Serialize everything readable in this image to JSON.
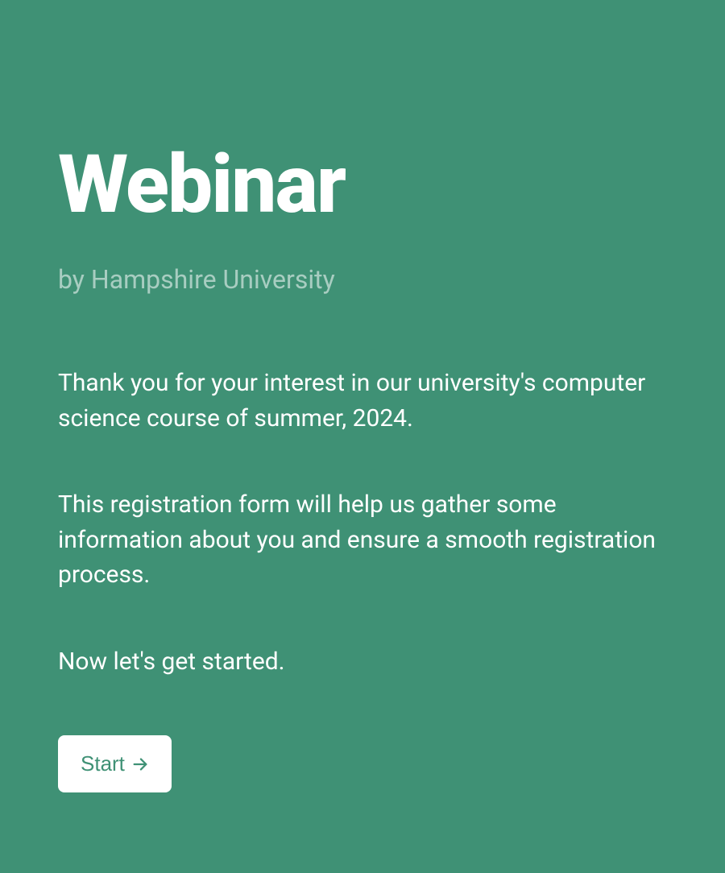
{
  "header": {
    "title": "Webinar",
    "subtitle": "by Hampshire University"
  },
  "body": {
    "paragraph1": "Thank you for your interest in our university's computer science course of summer, 2024.",
    "paragraph2": "This registration form will help us gather some information about you and ensure a smooth registration process.",
    "paragraph3": "Now let's get started."
  },
  "actions": {
    "start_label": "Start"
  }
}
